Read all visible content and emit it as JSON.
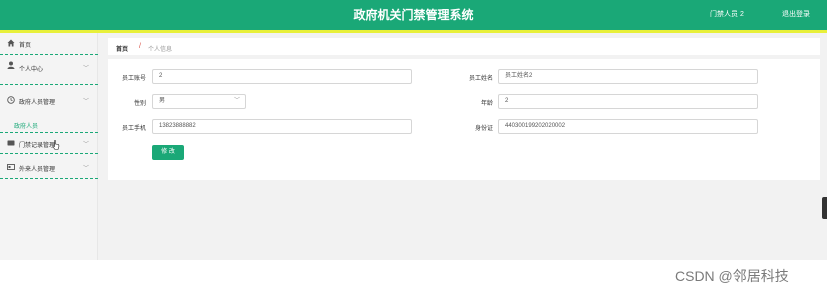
{
  "header": {
    "title": "政府机关门禁管理系统",
    "user_label": "门禁人员 2",
    "logout_label": "退出登录",
    "color": "#1aa877",
    "strip_color": "#e8f03a"
  },
  "sidebar": {
    "items": [
      {
        "label": "首页",
        "icon": "home-icon"
      },
      {
        "label": "个人中心",
        "icon": "user-icon"
      },
      {
        "label": "政府人员管理",
        "icon": "clock-icon"
      },
      {
        "label": "门禁记录管理",
        "icon": "card-icon"
      },
      {
        "label": "外来人员管理",
        "icon": "id-card-icon"
      }
    ],
    "sub_items": [
      {
        "label": "政府人员"
      }
    ],
    "chevron": "﹀"
  },
  "breadcrumb": {
    "home": "首页",
    "separator": "/",
    "current": "个人信息"
  },
  "form": {
    "fields": {
      "employee_no": {
        "label": "员工账号",
        "value": "2"
      },
      "employee_name": {
        "label": "员工姓名",
        "value": "员工姓名2"
      },
      "gender": {
        "label": "性别",
        "value": "男",
        "chevron": "﹀"
      },
      "age": {
        "label": "年龄",
        "value": "2"
      },
      "phone": {
        "label": "员工手机",
        "value": "13823888882"
      },
      "id_card": {
        "label": "身份证",
        "value": "440300199202020002"
      }
    },
    "submit_label": "修 改"
  },
  "watermark": "CSDN @邻居科技"
}
